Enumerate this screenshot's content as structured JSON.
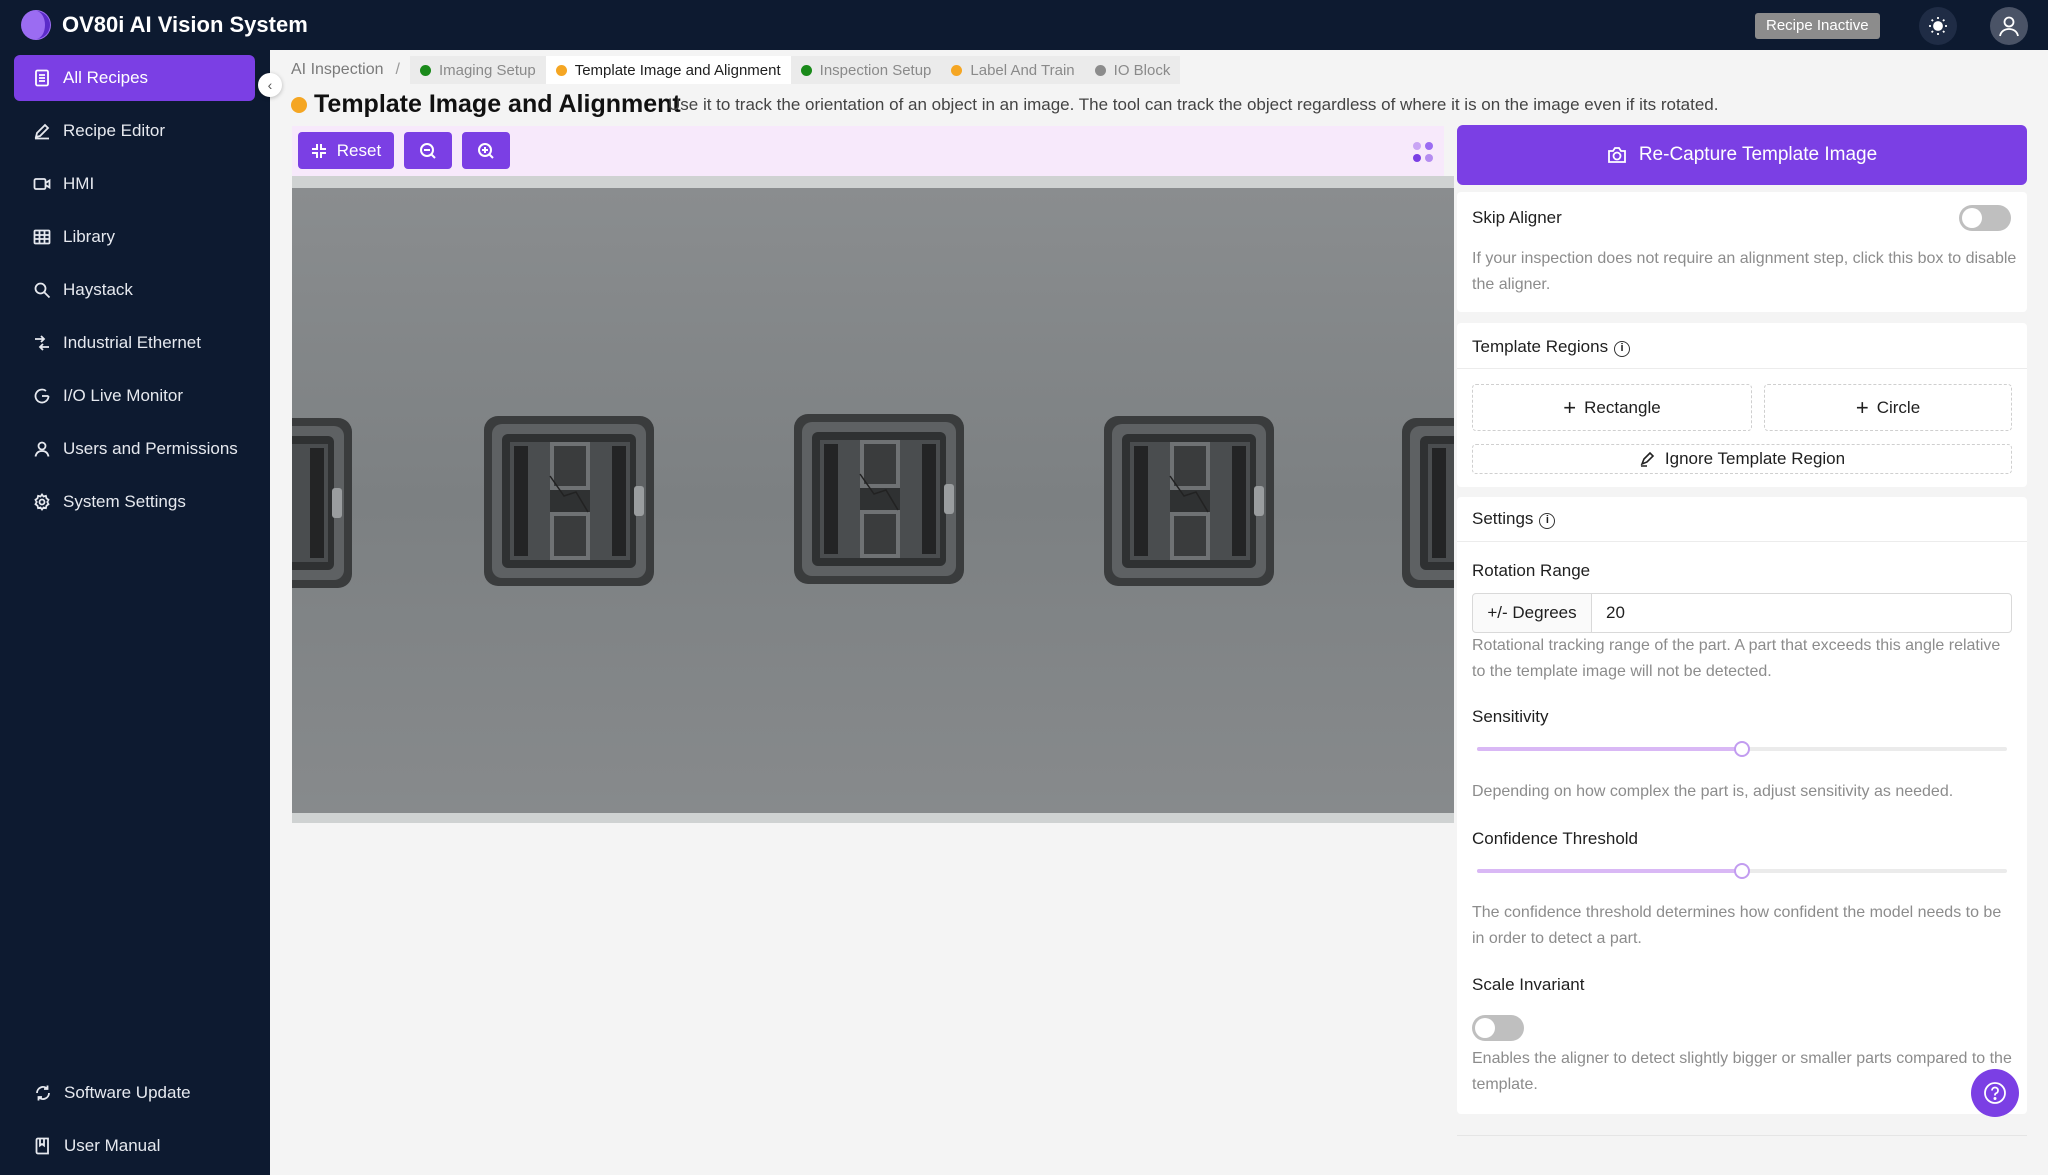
{
  "app": {
    "title": "OV80i AI Vision System",
    "status_badge": "Recipe Inactive"
  },
  "sidebar": {
    "items": [
      {
        "label": "All Recipes",
        "icon": "document-icon"
      },
      {
        "label": "Recipe Editor",
        "icon": "pencil-icon"
      },
      {
        "label": "HMI",
        "icon": "video-icon"
      },
      {
        "label": "Library",
        "icon": "table-icon"
      },
      {
        "label": "Haystack",
        "icon": "search-icon"
      },
      {
        "label": "Industrial Ethernet",
        "icon": "network-icon"
      },
      {
        "label": "I/O Live Monitor",
        "icon": "monitor-icon"
      },
      {
        "label": "Users and Permissions",
        "icon": "user-icon"
      },
      {
        "label": "System Settings",
        "icon": "gear-icon"
      }
    ],
    "bottom": [
      {
        "label": "Software Update",
        "icon": "refresh-icon"
      },
      {
        "label": "User Manual",
        "icon": "book-icon"
      }
    ]
  },
  "breadcrumb": {
    "root": "AI Inspection",
    "separator": "/",
    "steps": [
      {
        "label": "Imaging Setup",
        "color": "#1a8a1a"
      },
      {
        "label": "Template Image and Alignment",
        "color": "#f5a623"
      },
      {
        "label": "Inspection Setup",
        "color": "#1a8a1a"
      },
      {
        "label": "Label And Train",
        "color": "#f5a623"
      },
      {
        "label": "IO Block",
        "color": "#8c8c8c"
      }
    ]
  },
  "page": {
    "title": "Template Image and Alignment",
    "status_color": "#f5a623",
    "description": "Use it to track the orientation of an object in an image. The tool can track the object regardless of where it is on the image even if its rotated."
  },
  "toolbar": {
    "reset_label": "Reset"
  },
  "panel": {
    "recapture_label": "Re-Capture Template Image",
    "skip_aligner": {
      "label": "Skip Aligner",
      "enabled": false,
      "hint": "If your inspection does not require an alignment step, click this box to disable the aligner."
    },
    "template_regions": {
      "title": "Template Regions",
      "rectangle_label": "Rectangle",
      "circle_label": "Circle",
      "ignore_label": "Ignore Template Region"
    },
    "settings": {
      "title": "Settings",
      "rotation_range": {
        "label": "Rotation Range",
        "addon": "+/- Degrees",
        "value": "20",
        "hint": "Rotational tracking range of the part. A part that exceeds this angle relative to the template image will not be detected."
      },
      "sensitivity": {
        "label": "Sensitivity",
        "value_fraction": 0.5,
        "hint": "Depending on how complex the part is, adjust sensitivity as needed."
      },
      "confidence_threshold": {
        "label": "Confidence Threshold",
        "value_fraction": 0.5,
        "hint": "The confidence threshold determines how confident the model needs to be in order to detect a part."
      },
      "scale_invariant": {
        "label": "Scale Invariant",
        "enabled": false,
        "hint": "Enables the aligner to detect slightly bigger or smaller parts compared to the template."
      }
    }
  },
  "colors": {
    "accent": "#7b3fe4",
    "sidebar_bg": "#0d1a30"
  }
}
